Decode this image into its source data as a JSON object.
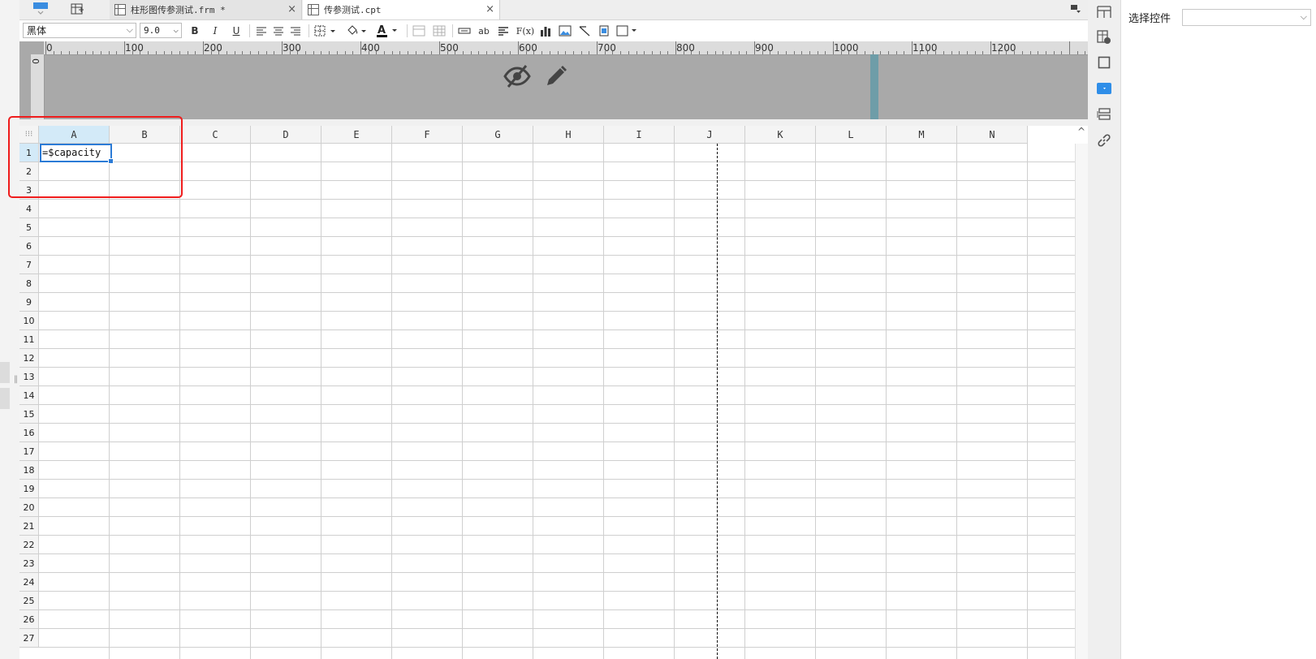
{
  "tabs": [
    {
      "label": "柱形图传参测试.frm *",
      "close": "×"
    },
    {
      "label": "传参测试.cpt",
      "close": "×"
    }
  ],
  "toolbar": {
    "font_family": "黑体",
    "font_size": "9.0",
    "bold": "B",
    "italic": "I",
    "underline": "U",
    "text_ab": "ab",
    "formula": "F(x)"
  },
  "ruler": {
    "top_labels": [
      "0",
      "100",
      "200",
      "300",
      "400",
      "500",
      "600",
      "700",
      "800",
      "900",
      "1000",
      "1100",
      "1200"
    ],
    "left_label": "0"
  },
  "grid": {
    "columns": [
      "A",
      "B",
      "C",
      "D",
      "E",
      "F",
      "G",
      "H",
      "I",
      "J",
      "K",
      "L",
      "M",
      "N"
    ],
    "rows": [
      "1",
      "2",
      "3",
      "4",
      "5",
      "6",
      "7",
      "8",
      "9",
      "10",
      "11",
      "12",
      "13",
      "14",
      "15",
      "16",
      "17",
      "18",
      "19",
      "20",
      "21",
      "22",
      "23",
      "24",
      "25",
      "26",
      "27"
    ],
    "active_column": "A",
    "active_row": "1",
    "cell_a1": "=$capacity"
  },
  "properties": {
    "label": "选择控件",
    "select_value": ""
  },
  "icons": {
    "tab_bar_left": "grid-table-icon",
    "tab_bar_right": "window-menu-icon",
    "preview_hide": "eye-off-icon",
    "preview_edit": "pencil-icon",
    "right_column": [
      "frame-icon",
      "cell-attr-icon",
      "border-icon",
      "widget-icon",
      "form-layout-icon",
      "link-icon"
    ]
  },
  "colors": {
    "accent": "#2b7bd6",
    "highlight": "#ef1c1c",
    "active_header": "#d3eaf8",
    "widget_active": "#2f8ee8"
  }
}
